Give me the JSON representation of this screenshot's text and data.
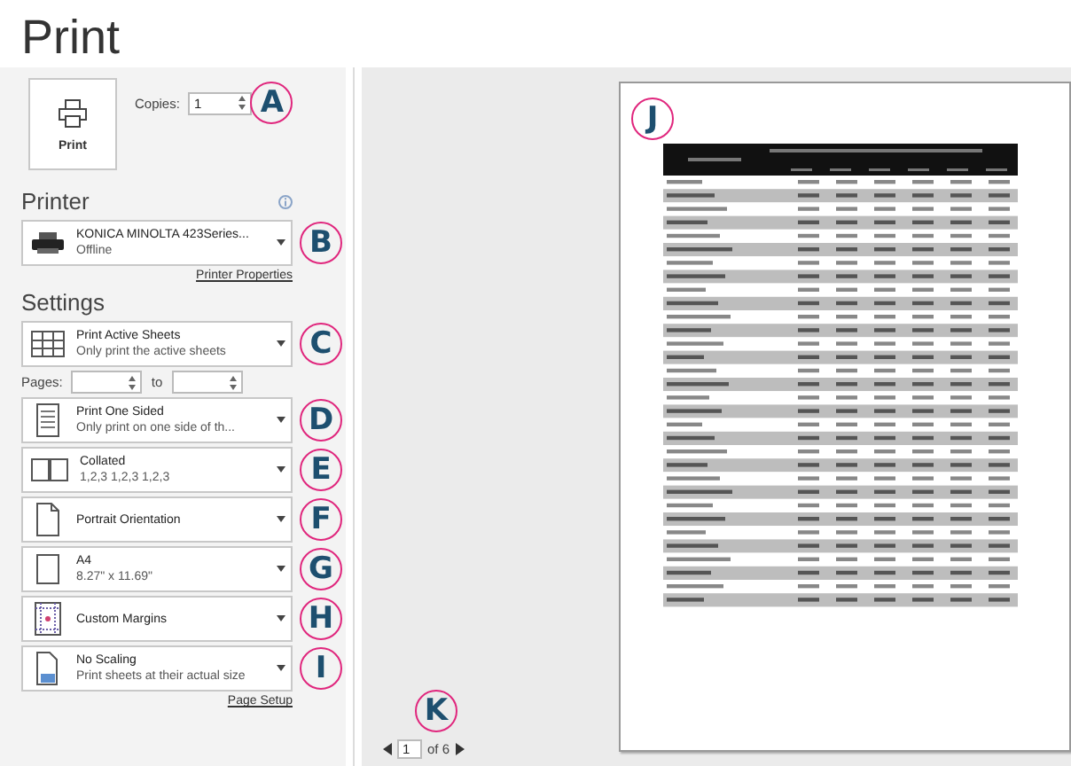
{
  "title": "Print",
  "print_button": {
    "label": "Print"
  },
  "copies": {
    "label": "Copies:",
    "value": "1",
    "annotation": "A"
  },
  "printer": {
    "heading": "Printer",
    "name": "KONICA MINOLTA 423Series...",
    "status": "Offline",
    "annotation": "B",
    "properties_link": "Printer Properties"
  },
  "settings": {
    "heading": "Settings",
    "items": [
      {
        "kind": "sheets",
        "title": "Print Active Sheets",
        "subtitle": "Only print the active sheets",
        "annotation": "C"
      },
      {
        "kind": "pages",
        "label": "Pages:",
        "to_label": "to"
      },
      {
        "kind": "sided",
        "title": "Print One Sided",
        "subtitle": "Only print on one side of th...",
        "annotation": "D"
      },
      {
        "kind": "collated",
        "title": "Collated",
        "subtitle": "1,2,3    1,2,3    1,2,3",
        "annotation": "E"
      },
      {
        "kind": "orientation",
        "title": "Portrait Orientation",
        "annotation": "F"
      },
      {
        "kind": "paper",
        "title": "A4",
        "subtitle": "8.27\" x 11.69\"",
        "annotation": "G"
      },
      {
        "kind": "margins",
        "title": "Custom Margins",
        "annotation": "H"
      },
      {
        "kind": "scaling",
        "title": "No Scaling",
        "subtitle": "Print sheets at their actual size",
        "annotation": "I"
      }
    ],
    "page_setup_link": "Page Setup"
  },
  "preview": {
    "annotation": "J"
  },
  "pager": {
    "page": "1",
    "of": "of 6",
    "annotation": "K"
  }
}
